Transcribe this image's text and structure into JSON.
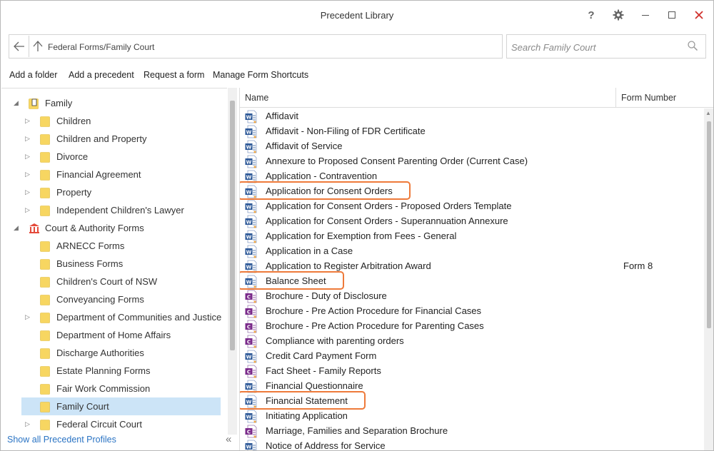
{
  "window": {
    "title": "Precedent Library"
  },
  "titlebar_icons": {
    "help": "?",
    "gear": "gear-icon",
    "minimize": "minimize-icon",
    "maximize": "maximize-icon",
    "close": "close-icon"
  },
  "address": {
    "path": "Federal Forms/Family Court"
  },
  "search": {
    "placeholder": "Search Family Court"
  },
  "toolbar": {
    "add_folder": "Add a folder",
    "add_precedent": "Add a precedent",
    "request_form": "Request a form",
    "manage_shortcuts": "Manage Form Shortcuts"
  },
  "tree": {
    "items": [
      {
        "label": "Family",
        "level": 0,
        "expanded": true,
        "icon": "doc-folder"
      },
      {
        "label": "Children",
        "level": 1,
        "expandable": true
      },
      {
        "label": "Children and Property",
        "level": 1,
        "expandable": true
      },
      {
        "label": "Divorce",
        "level": 1,
        "expandable": true
      },
      {
        "label": "Financial Agreement",
        "level": 1,
        "expandable": true
      },
      {
        "label": "Property",
        "level": 1,
        "expandable": true
      },
      {
        "label": "Independent Children's Lawyer",
        "level": 1,
        "expandable": true
      },
      {
        "label": "Court & Authority Forms",
        "level": 0,
        "expanded": true,
        "icon": "court"
      },
      {
        "label": "ARNECC Forms",
        "level": 1,
        "expandable": false
      },
      {
        "label": "Business Forms",
        "level": 1,
        "expandable": false
      },
      {
        "label": "Children's Court of NSW",
        "level": 1,
        "expandable": false
      },
      {
        "label": "Conveyancing Forms",
        "level": 1,
        "expandable": false
      },
      {
        "label": "Department of Communities and Justice",
        "level": 1,
        "expandable": true
      },
      {
        "label": "Department of Home Affairs",
        "level": 1,
        "expandable": false
      },
      {
        "label": "Discharge Authorities",
        "level": 1,
        "expandable": false
      },
      {
        "label": "Estate Planning Forms",
        "level": 1,
        "expandable": false
      },
      {
        "label": "Fair Work Commission",
        "level": 1,
        "expandable": false
      },
      {
        "label": "Family Court",
        "level": 1,
        "expandable": false,
        "selected": true
      },
      {
        "label": "Federal Circuit Court",
        "level": 1,
        "expandable": true
      }
    ],
    "footer_link": "Show all Precedent Profiles"
  },
  "list": {
    "columns": {
      "name": "Name",
      "form_number": "Form Number"
    },
    "rows": [
      {
        "name": "Affidavit",
        "form": "",
        "type": "word"
      },
      {
        "name": "Affidavit - Non-Filing of FDR Certificate",
        "form": "",
        "type": "word"
      },
      {
        "name": "Affidavit of Service",
        "form": "",
        "type": "word"
      },
      {
        "name": "Annexure to Proposed Consent Parenting Order (Current Case)",
        "form": "",
        "type": "word"
      },
      {
        "name": "Application - Contravention",
        "form": "",
        "type": "word"
      },
      {
        "name": "Application for Consent Orders",
        "form": "",
        "type": "word",
        "highlight": true
      },
      {
        "name": "Application for Consent Orders - Proposed Orders Template",
        "form": "",
        "type": "word"
      },
      {
        "name": "Application for Consent Orders - Superannuation Annexure",
        "form": "",
        "type": "word"
      },
      {
        "name": "Application for Exemption from Fees - General",
        "form": "",
        "type": "word"
      },
      {
        "name": "Application in a Case",
        "form": "",
        "type": "word"
      },
      {
        "name": "Application to Register Arbitration Award",
        "form": "Form 8",
        "type": "word"
      },
      {
        "name": "Balance Sheet",
        "form": "",
        "type": "word",
        "highlight": true
      },
      {
        "name": "Brochure - Duty of Disclosure",
        "form": "",
        "type": "pdf"
      },
      {
        "name": "Brochure - Pre Action Procedure for Financial Cases",
        "form": "",
        "type": "pdf"
      },
      {
        "name": "Brochure - Pre Action Procedure for Parenting Cases",
        "form": "",
        "type": "pdf"
      },
      {
        "name": "Compliance with parenting orders",
        "form": "",
        "type": "pdf"
      },
      {
        "name": "Credit Card Payment Form",
        "form": "",
        "type": "word"
      },
      {
        "name": "Fact Sheet - Family Reports",
        "form": "",
        "type": "pdf"
      },
      {
        "name": "Financial Questionnaire",
        "form": "",
        "type": "word"
      },
      {
        "name": "Financial Statement",
        "form": "",
        "type": "word",
        "highlight": true
      },
      {
        "name": "Initiating Application",
        "form": "",
        "type": "word"
      },
      {
        "name": "Marriage, Families and Separation Brochure",
        "form": "",
        "type": "pdf"
      },
      {
        "name": "Notice of Address for Service",
        "form": "",
        "type": "word"
      }
    ]
  },
  "colors": {
    "accent": "#2b74c4",
    "highlight": "#ee7a3a",
    "selection": "#cce4f7",
    "folder": "#f7d661",
    "word": "#2b5797",
    "pdf": "#7a2a8a"
  }
}
